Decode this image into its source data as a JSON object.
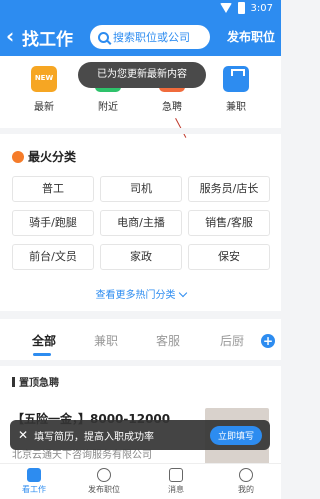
{
  "status": {
    "time": "3:07"
  },
  "header": {
    "title": "找工作",
    "search_placeholder": "搜索职位或公司",
    "post_label": "发布职位"
  },
  "quick": [
    {
      "label": "最新"
    },
    {
      "label": "附近"
    },
    {
      "label": "急聘"
    },
    {
      "label": "兼职"
    }
  ],
  "toast": {
    "text": "已为您更新最新内容"
  },
  "hot": {
    "title": "最火分类",
    "items": [
      "普工",
      "司机",
      "服务员/店长",
      "骑手/跑腿",
      "电商/主播",
      "销售/客服",
      "前台/文员",
      "家政",
      "保安"
    ],
    "more": "查看更多热门分类"
  },
  "tabs": [
    {
      "label": "全部",
      "active": true
    },
    {
      "label": "兼职",
      "active": false
    },
    {
      "label": "客服",
      "active": false
    },
    {
      "label": "后厨",
      "active": false
    }
  ],
  "pinned": {
    "title": "置顶急聘"
  },
  "job": {
    "title": "【五险一金，】8000-12000",
    "company": "北京云通天下咨询服务有限公司"
  },
  "banner": {
    "text": "填写简历，提高入职成功率",
    "button": "立即填写"
  },
  "nav": [
    {
      "label": "看工作",
      "active": true
    },
    {
      "label": "发布职位",
      "active": false
    },
    {
      "label": "消息",
      "active": false
    },
    {
      "label": "我的",
      "active": false
    }
  ]
}
